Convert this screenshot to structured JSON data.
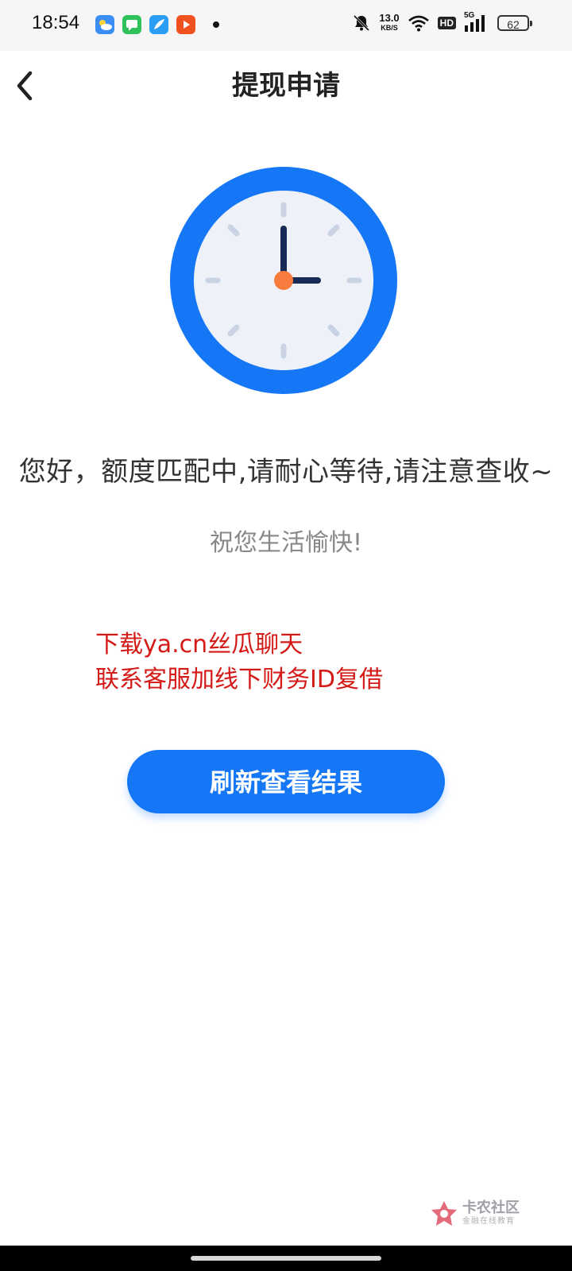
{
  "status_bar": {
    "time": "18:54",
    "network_speed_value": "13.0",
    "network_speed_unit": "KB/S",
    "hd_label": "HD",
    "signal_label": "5G",
    "battery": "62"
  },
  "nav": {
    "title": "提现申请"
  },
  "content": {
    "main_message": "您好，额度匹配中,请耐心等待,请注意查收~",
    "sub_message": "祝您生活愉快!",
    "notice_line1": "下载ya.cn丝瓜聊天",
    "notice_line2": "联系客服加线下财务ID复借",
    "refresh_button": "刷新查看结果"
  },
  "watermark": {
    "title": "卡农社区",
    "subtitle": "金融在线教育"
  },
  "colors": {
    "accent": "#1677f6",
    "clock_hour_hand": "#1a2a57",
    "clock_center": "#f97b3d",
    "notice_red": "#d41a16"
  }
}
